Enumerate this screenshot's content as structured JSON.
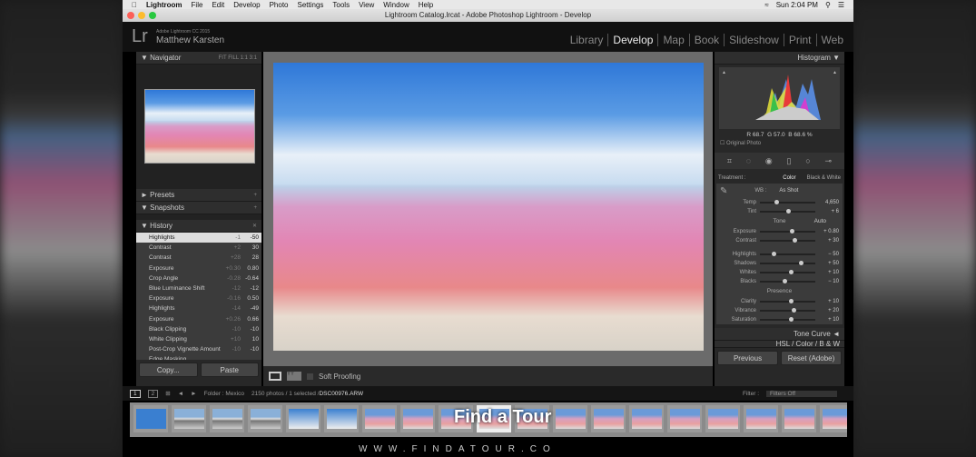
{
  "menubar": {
    "apple": "",
    "app": "Lightroom",
    "items": [
      "File",
      "Edit",
      "Develop",
      "Photo",
      "Settings",
      "Tools",
      "View",
      "Window",
      "Help"
    ],
    "clock": "Sun 2:04 PM"
  },
  "window": {
    "title": "Lightroom Catalog.lrcat - Adobe Photoshop Lightroom - Develop"
  },
  "identity": {
    "logo": "Lr",
    "product": "Adobe Lightroom CC 2015",
    "user": "Matthew Karsten"
  },
  "modules": [
    "Library",
    "Develop",
    "Map",
    "Book",
    "Slideshow",
    "Print",
    "Web"
  ],
  "left": {
    "navigator": "Navigator",
    "zoom": "FIT  FILL  1:1  3:1",
    "presets": "Presets",
    "snapshots": "Snapshots",
    "history": "History",
    "history_items": [
      [
        "Highlights",
        "-1",
        "-50"
      ],
      [
        "Contrast",
        "+2",
        "30"
      ],
      [
        "Contrast",
        "+28",
        "28"
      ],
      [
        "Exposure",
        "+0.30",
        "0.80"
      ],
      [
        "Crop Angle",
        "-0.28",
        "-0.64"
      ],
      [
        "Blue Luminance Shift",
        "-12",
        "-12"
      ],
      [
        "Exposure",
        "-0.16",
        "0.50"
      ],
      [
        "Highlights",
        "-14",
        "-49"
      ],
      [
        "Exposure",
        "+0.26",
        "0.66"
      ],
      [
        "Black Clipping",
        "-10",
        "-10"
      ],
      [
        "White Clipping",
        "+10",
        "10"
      ],
      [
        "Post-Crop Vignette Amount",
        "-10",
        "-10"
      ],
      [
        "Edge Masking",
        "",
        ""
      ]
    ],
    "copy": "Copy...",
    "paste": "Paste"
  },
  "toolbar": {
    "soft_proofing": "Soft Proofing"
  },
  "right": {
    "histogram": "Histogram",
    "r": "68.7",
    "g": "57.0",
    "b": "68.6",
    "rgb_unit": "%",
    "original_photo": "Original Photo",
    "treatment": "Treatment :",
    "color": "Color",
    "bw": "Black & White",
    "wb_label": "WB :",
    "wb": "As Shot",
    "basic1": [
      {
        "name": "Temp",
        "value": "4,650",
        "pos": 0.3
      },
      {
        "name": "Tint",
        "value": "+ 6",
        "pos": 0.5
      }
    ],
    "tone": "Tone",
    "auto": "Auto",
    "tone_sliders": [
      {
        "name": "Exposure",
        "value": "+ 0.80",
        "pos": 0.58
      },
      {
        "name": "Contrast",
        "value": "+ 30",
        "pos": 0.62
      }
    ],
    "tone_sliders2": [
      {
        "name": "Highlights",
        "value": "− 50",
        "pos": 0.25
      },
      {
        "name": "Shadows",
        "value": "+ 50",
        "pos": 0.73
      },
      {
        "name": "Whites",
        "value": "+ 10",
        "pos": 0.55
      },
      {
        "name": "Blacks",
        "value": "− 10",
        "pos": 0.45
      }
    ],
    "presence": "Presence",
    "presence_sliders": [
      {
        "name": "Clarity",
        "value": "+ 10",
        "pos": 0.55
      },
      {
        "name": "Vibrance",
        "value": "+ 20",
        "pos": 0.6
      },
      {
        "name": "Saturation",
        "value": "+ 10",
        "pos": 0.55
      }
    ],
    "tone_curve": "Tone Curve",
    "hsl": "HSL / Color / B & W",
    "previous": "Previous",
    "reset": "Reset (Adobe)"
  },
  "filmstrip": {
    "view1": "1",
    "view2": "2",
    "folder": "Folder : Mexico",
    "count": "2150 photos / 1 selected /",
    "file": "DSC00976.ARW",
    "filter_label": "Filter :",
    "filter": "Filters Off"
  },
  "watermark": {
    "brand": "Find a Tour",
    "url": "WWW.FINDATOUR.CO"
  }
}
